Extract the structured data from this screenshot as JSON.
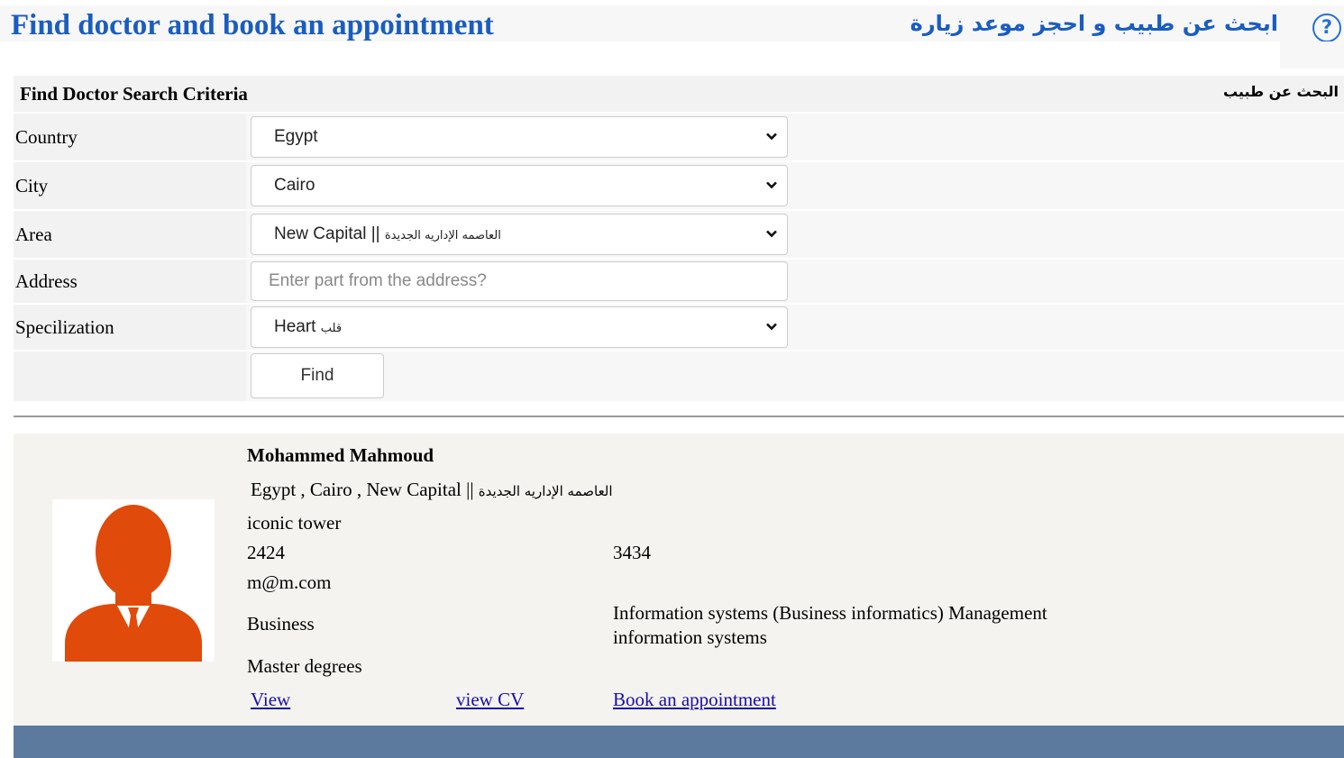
{
  "header": {
    "title_en": "Find doctor and book an appointment",
    "title_ar": "ابحث عن طبيب و احجز موعد زيارة",
    "help_label": "?"
  },
  "criteria": {
    "title_en": "Find Doctor Search Criteria",
    "title_ar": "البحث عن طبيب"
  },
  "form": {
    "country": {
      "label": "Country",
      "value": "Egypt"
    },
    "city": {
      "label": "City",
      "value": "Cairo"
    },
    "area": {
      "label": "Area",
      "value_en": "New Capital ||",
      "value_ar": "العاصمه الإداريه الجديدة"
    },
    "address": {
      "label": "Address",
      "placeholder": "Enter part from the address?"
    },
    "specialization": {
      "label": "Specilization",
      "value_en": "Heart",
      "value_ar": "قلب"
    },
    "find_label": "Find"
  },
  "result": {
    "name": "Mohammed Mahmoud",
    "location_en": "Egypt , Cairo , New Capital ||",
    "location_ar": "العاصمه الإداريه الجديدة",
    "address": "iconic tower",
    "phone1": "2424",
    "phone2": "3434",
    "email": "m@m.com",
    "field": "Business",
    "description": "Information systems (Business informatics) Management information systems",
    "degree": "Master degrees",
    "links": {
      "view": "View",
      "view_cv": "view CV",
      "book": "Book an appointment"
    },
    "avatar_icon": "doctor-avatar-icon",
    "avatar_color": "#e04a0a"
  },
  "colors": {
    "title": "#1a5dbf",
    "link": "#1a0dab",
    "footer": "#5c7a9d"
  }
}
